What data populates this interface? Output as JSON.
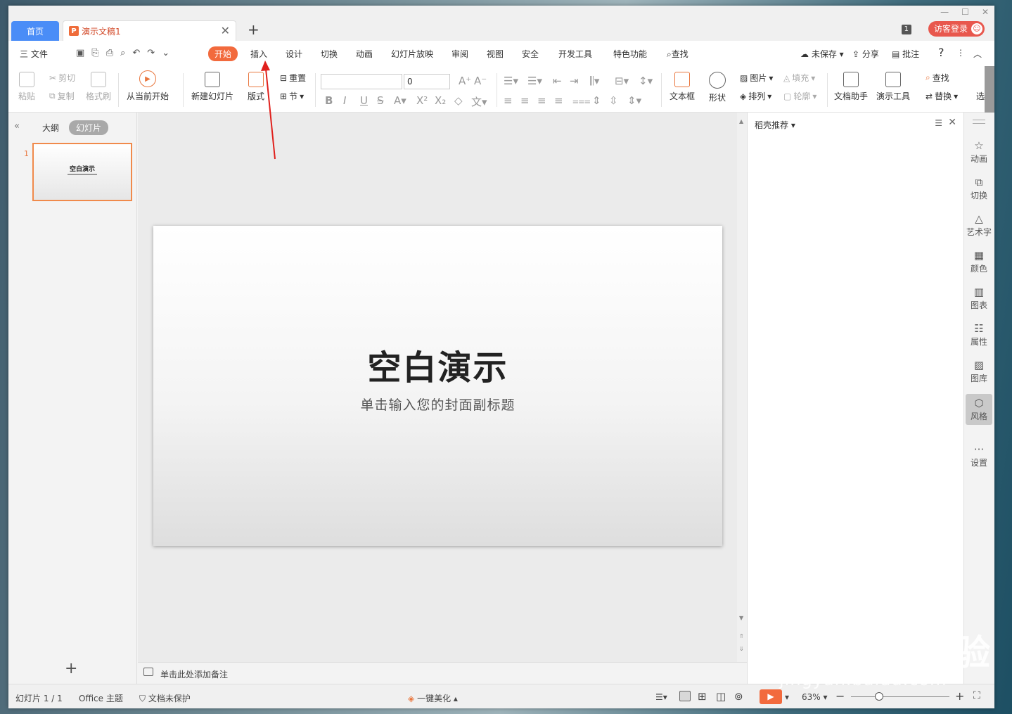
{
  "tabs": {
    "home": "首页",
    "doc": "演示文稿1",
    "doc_icon": "P"
  },
  "window": {
    "badge": "1",
    "login": "访客登录"
  },
  "menu": {
    "file": "三 文件",
    "tabs": [
      "开始",
      "插入",
      "设计",
      "切换",
      "动画",
      "幻灯片放映",
      "审阅",
      "视图",
      "安全",
      "开发工具",
      "特色功能"
    ],
    "search": "查找",
    "unsaved": "未保存",
    "share": "分享",
    "comment": "批注",
    "help": "?"
  },
  "ribbon": {
    "paste": "粘贴",
    "cut": "剪切",
    "copy": "复制",
    "format_painter": "格式刷",
    "from_current": "从当前开始",
    "new_slide": "新建幻灯片",
    "layout": "版式",
    "reset": "重置",
    "section": "节",
    "font_size": "0",
    "textbox": "文本框",
    "shape": "形状",
    "picture": "图片",
    "arrange": "排列",
    "fill": "填充",
    "outline": "轮廓",
    "doc_assistant": "文档助手",
    "present_tools": "演示工具",
    "find": "查找",
    "replace": "替换",
    "select": "选"
  },
  "left_panel": {
    "outline": "大纲",
    "slides": "幻灯片",
    "slide_number": "1",
    "thumb_title": "空白演示"
  },
  "slide": {
    "title": "空白演示",
    "subtitle": "单击输入您的封面副标题"
  },
  "notes": {
    "placeholder": "单击此处添加备注"
  },
  "task_pane": {
    "title": "稻壳推荐"
  },
  "right_sidebar": [
    "动画",
    "切换",
    "艺术字",
    "颜色",
    "图表",
    "属性",
    "图库",
    "风格",
    "设置"
  ],
  "status": {
    "slide_count": "幻灯片 1 / 1",
    "theme": "Office 主题",
    "protect": "文档未保护",
    "beautify": "一键美化",
    "zoom": "63%"
  },
  "watermark": {
    "brand": "Bai du 经验",
    "url": "jingyan.baidu.com"
  },
  "colors": {
    "accent": "#f26a3d",
    "home_tab": "#4a8df7",
    "login": "#e8574d",
    "arrow": "#e0201c"
  }
}
